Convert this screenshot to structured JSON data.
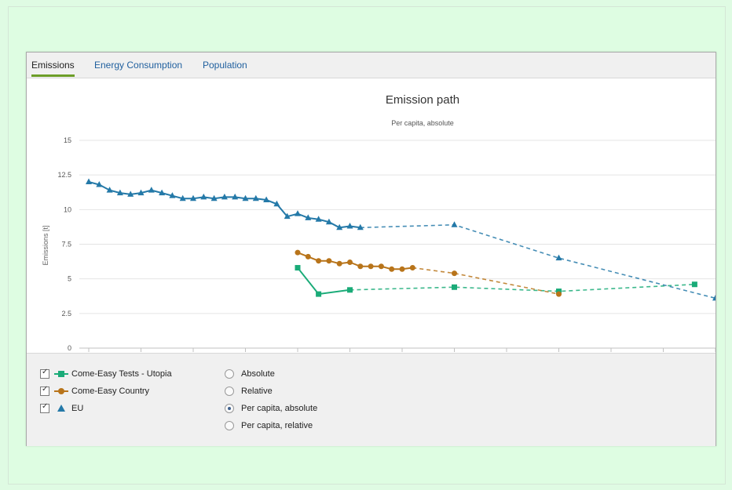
{
  "tabs": [
    {
      "label": "Emissions",
      "active": true
    },
    {
      "label": "Energy Consumption",
      "active": false
    },
    {
      "label": "Population",
      "active": false
    }
  ],
  "chart_data": {
    "type": "line",
    "title": "Emission path",
    "subtitle": "Per capita, absolute",
    "xlabel": "",
    "ylabel": "Emissions [t]",
    "ylim": [
      0,
      15
    ],
    "yticks": [
      "0",
      "2.5",
      "5",
      "7.5",
      "10",
      "12.5",
      "15"
    ],
    "grid": true,
    "series": [
      {
        "name": "Come-Easy Tests - Utopia",
        "color": "#1aab78",
        "marker": "square",
        "actual": [
          [
            2010,
            5.8
          ],
          [
            2012,
            3.9
          ],
          [
            2015,
            4.2
          ]
        ],
        "projection": [
          [
            2015,
            4.2
          ],
          [
            2025,
            4.4
          ],
          [
            2035,
            4.1
          ],
          [
            2048,
            4.6
          ]
        ]
      },
      {
        "name": "Come-Easy Country",
        "color": "#b8741a",
        "marker": "circle",
        "actual": [
          [
            2010,
            6.9
          ],
          [
            2011,
            6.6
          ],
          [
            2012,
            6.3
          ],
          [
            2013,
            6.3
          ],
          [
            2014,
            6.1
          ],
          [
            2015,
            6.2
          ],
          [
            2016,
            5.9
          ],
          [
            2017,
            5.9
          ],
          [
            2018,
            5.9
          ],
          [
            2019,
            5.7
          ],
          [
            2020,
            5.7
          ],
          [
            2021,
            5.8
          ]
        ],
        "projection": [
          [
            2021,
            5.8
          ],
          [
            2025,
            5.4
          ],
          [
            2035,
            3.9
          ]
        ]
      },
      {
        "name": "EU",
        "color": "#2479a8",
        "marker": "triangle",
        "actual": [
          [
            1990,
            12.0
          ],
          [
            1991,
            11.8
          ],
          [
            1992,
            11.4
          ],
          [
            1993,
            11.2
          ],
          [
            1994,
            11.1
          ],
          [
            1995,
            11.2
          ],
          [
            1996,
            11.4
          ],
          [
            1997,
            11.2
          ],
          [
            1998,
            11.0
          ],
          [
            1999,
            10.8
          ],
          [
            2000,
            10.8
          ],
          [
            2001,
            10.9
          ],
          [
            2002,
            10.8
          ],
          [
            2003,
            10.9
          ],
          [
            2004,
            10.9
          ],
          [
            2005,
            10.8
          ],
          [
            2006,
            10.8
          ],
          [
            2007,
            10.7
          ],
          [
            2008,
            10.4
          ],
          [
            2009,
            9.5
          ],
          [
            2010,
            9.7
          ],
          [
            2011,
            9.4
          ],
          [
            2012,
            9.3
          ],
          [
            2013,
            9.1
          ],
          [
            2014,
            8.7
          ],
          [
            2015,
            8.8
          ],
          [
            2016,
            8.7
          ]
        ],
        "projection": [
          [
            2016,
            8.7
          ],
          [
            2025,
            8.9
          ],
          [
            2035,
            6.5
          ],
          [
            2050,
            3.6
          ]
        ]
      }
    ]
  },
  "legend": {
    "series": [
      {
        "label": "Come-Easy Tests - Utopia",
        "checked": true,
        "color": "#1aab78",
        "marker": "square"
      },
      {
        "label": "Come-Easy Country",
        "checked": true,
        "color": "#b8741a",
        "marker": "circle"
      },
      {
        "label": "EU",
        "checked": true,
        "color": "#2479a8",
        "marker": "triangle"
      }
    ],
    "modes": [
      {
        "label": "Absolute",
        "checked": false
      },
      {
        "label": "Relative",
        "checked": false
      },
      {
        "label": "Per capita, absolute",
        "checked": true
      },
      {
        "label": "Per capita, relative",
        "checked": false
      }
    ]
  }
}
